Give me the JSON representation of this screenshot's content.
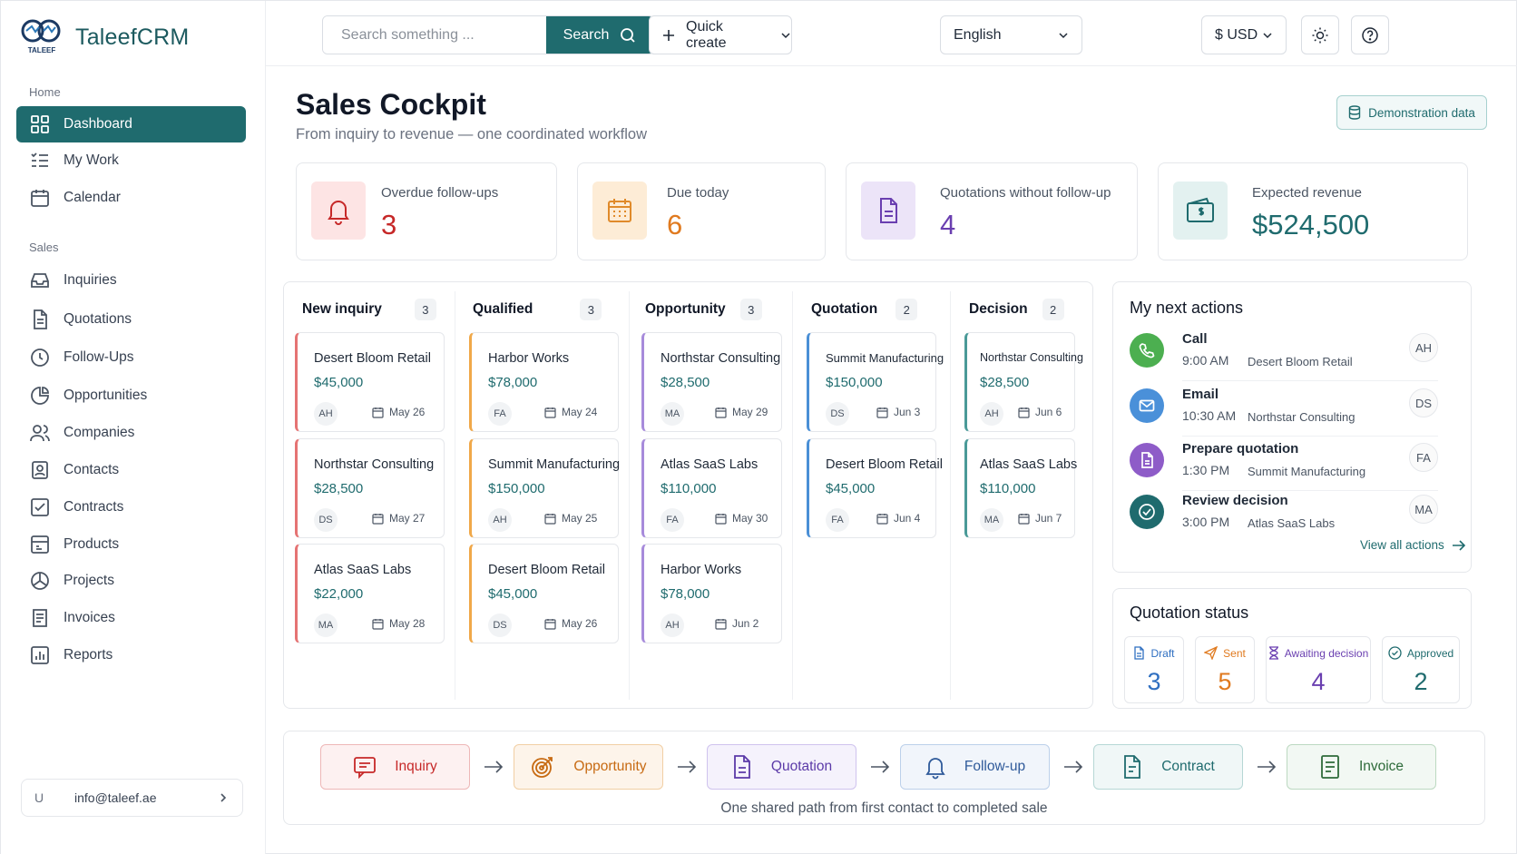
{
  "app": {
    "name": "TaleefCRM",
    "logo_text": "TALEEF"
  },
  "sidebar": {
    "sections": [
      {
        "label": "Home"
      },
      {
        "label": "Sales"
      }
    ],
    "items": [
      {
        "label": "Dashboard",
        "icon": "grid-icon",
        "active": true
      },
      {
        "label": "My Work",
        "icon": "list-icon"
      },
      {
        "label": "Calendar",
        "icon": "calendar-icon"
      },
      {
        "label": "Inquiries",
        "icon": "inbox-icon"
      },
      {
        "label": "Quotations",
        "icon": "document-icon"
      },
      {
        "label": "Follow-Ups",
        "icon": "clock-icon"
      },
      {
        "label": "Opportunities",
        "icon": "pie-icon"
      },
      {
        "label": "Companies",
        "icon": "users-icon"
      },
      {
        "label": "Contacts",
        "icon": "contact-icon"
      },
      {
        "label": "Contracts",
        "icon": "checkbox-icon"
      },
      {
        "label": "Products",
        "icon": "product-icon"
      },
      {
        "label": "Projects",
        "icon": "projects-icon"
      },
      {
        "label": "Invoices",
        "icon": "invoice-icon"
      },
      {
        "label": "Reports",
        "icon": "reports-icon"
      }
    ],
    "user": {
      "initial": "U",
      "email": "info@taleef.ae"
    }
  },
  "topbar": {
    "search_placeholder": "Search something ...",
    "search_label": "Search",
    "quick_create": "Quick create",
    "language": "English",
    "currency": "$ USD"
  },
  "page": {
    "title": "Sales Cockpit",
    "subtitle": "From inquiry to revenue — one coordinated workflow",
    "demo_label": "Demonstration data"
  },
  "kpis": [
    {
      "label": "Overdue follow-ups",
      "value": "3",
      "color": "#c62828"
    },
    {
      "label": "Due today",
      "value": "6",
      "color": "#e07a1f"
    },
    {
      "label": "Quotations without follow-up",
      "value": "4",
      "color": "#6a3fb0"
    },
    {
      "label": "Expected revenue",
      "value": "$524,500",
      "color": "#1f6b6e"
    }
  ],
  "pipeline": {
    "columns": [
      {
        "name": "New inquiry",
        "count": "3",
        "color": "#e57373",
        "cards": [
          {
            "company": "Desert Bloom Retail",
            "amount": "$45,000",
            "owner": "AH",
            "date": "May 26"
          },
          {
            "company": "Northstar Consulting",
            "amount": "$28,500",
            "owner": "DS",
            "date": "May 27"
          },
          {
            "company": "Atlas SaaS Labs",
            "amount": "$22,000",
            "owner": "MA",
            "date": "May 28"
          }
        ]
      },
      {
        "name": "Qualified",
        "count": "3",
        "color": "#f0a849",
        "cards": [
          {
            "company": "Harbor Works",
            "amount": "$78,000",
            "owner": "FA",
            "date": "May 24"
          },
          {
            "company": "Summit Manufacturing",
            "amount": "$150,000",
            "owner": "AH",
            "date": "May 25"
          },
          {
            "company": "Desert Bloom Retail",
            "amount": "$45,000",
            "owner": "DS",
            "date": "May 26"
          }
        ]
      },
      {
        "name": "Opportunity",
        "count": "3",
        "color": "#a78bdb",
        "cards": [
          {
            "company": "Northstar Consulting",
            "amount": "$28,500",
            "owner": "MA",
            "date": "May 29"
          },
          {
            "company": "Atlas SaaS Labs",
            "amount": "$110,000",
            "owner": "FA",
            "date": "May 30"
          },
          {
            "company": "Harbor Works",
            "amount": "$78,000",
            "owner": "AH",
            "date": "Jun 2"
          }
        ]
      },
      {
        "name": "Quotation",
        "count": "2",
        "color": "#4a8fd6",
        "cards": [
          {
            "company": "Summit Manufacturing",
            "amount": "$150,000",
            "owner": "DS",
            "date": "Jun 3"
          },
          {
            "company": "Desert Bloom Retail",
            "amount": "$45,000",
            "owner": "FA",
            "date": "Jun 4"
          }
        ]
      },
      {
        "name": "Decision",
        "count": "2",
        "color": "#4a9a98",
        "cards": [
          {
            "company": "Northstar Consulting",
            "amount": "$28,500",
            "owner": "AH",
            "date": "Jun 6"
          },
          {
            "company": "Atlas SaaS Labs",
            "amount": "$110,000",
            "owner": "MA",
            "date": "Jun 7"
          }
        ]
      }
    ]
  },
  "next_actions": {
    "title": "My next actions",
    "items": [
      {
        "type": "Call",
        "time": "9:00 AM",
        "company": "Desert Bloom Retail",
        "owner": "AH",
        "color": "#4caf50",
        "icon": "phone-icon"
      },
      {
        "type": "Email",
        "time": "10:30 AM",
        "company": "Northstar Consulting",
        "owner": "DS",
        "color": "#4a90d9",
        "icon": "mail-icon"
      },
      {
        "type": "Prepare quotation",
        "time": "1:30 PM",
        "company": "Summit Manufacturing",
        "owner": "FA",
        "color": "#8e5cc8",
        "icon": "document-icon"
      },
      {
        "type": "Review decision",
        "time": "3:00 PM",
        "company": "Atlas SaaS Labs",
        "owner": "MA",
        "color": "#1f6b6e",
        "icon": "check-circle-icon"
      }
    ],
    "view_all": "View all actions"
  },
  "quotation_status": {
    "title": "Quotation status",
    "tiles": [
      {
        "label": "Draft",
        "value": "3",
        "color": "#2f6fc1",
        "icon": "document-icon"
      },
      {
        "label": "Sent",
        "value": "5",
        "color": "#e07a1f",
        "icon": "send-icon"
      },
      {
        "label": "Awaiting decision",
        "value": "4",
        "color": "#6a3fb0",
        "icon": "hourglass-icon"
      },
      {
        "label": "Approved",
        "value": "2",
        "color": "#1f6b6e",
        "icon": "check-circle-icon"
      }
    ]
  },
  "flow": {
    "steps": [
      {
        "label": "Inquiry",
        "color": "#c62828",
        "bg": "#fdf1f1",
        "border": "#eeb7b7",
        "icon": "message-icon"
      },
      {
        "label": "Opportunity",
        "color": "#c76a12",
        "bg": "#fdf4ea",
        "border": "#f1cfa4",
        "icon": "target-icon"
      },
      {
        "label": "Quotation",
        "color": "#5b3aa8",
        "bg": "#f5f2fc",
        "border": "#cfc3ee",
        "icon": "document-icon"
      },
      {
        "label": "Follow-up",
        "color": "#2f5a9a",
        "bg": "#f1f5fb",
        "border": "#bcd0ea",
        "icon": "bell-icon"
      },
      {
        "label": "Contract",
        "color": "#1f6b6e",
        "bg": "#f0f7f7",
        "border": "#b6d7d5",
        "icon": "contract-icon"
      },
      {
        "label": "Invoice",
        "color": "#2e6b3a",
        "bg": "#f2f8f3",
        "border": "#bcd9c1",
        "icon": "invoice-icon"
      }
    ],
    "caption": "One shared path from first contact to completed sale"
  }
}
